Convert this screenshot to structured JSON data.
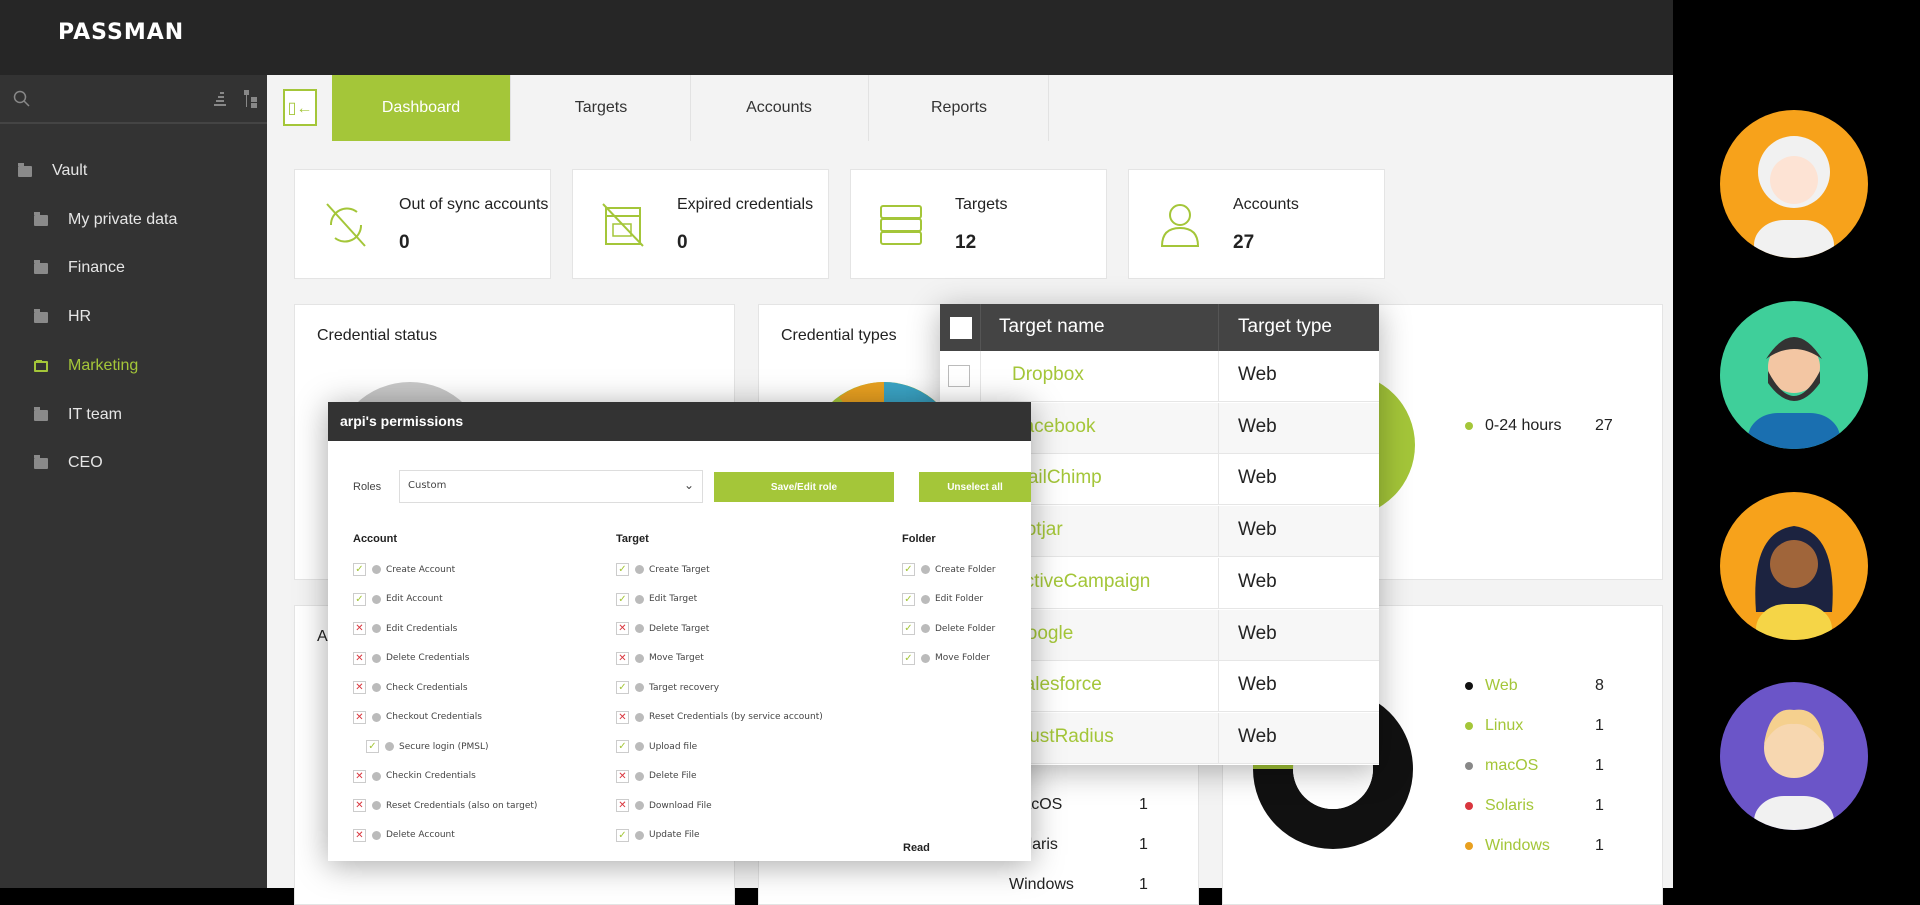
{
  "app": {
    "logo": "PASSMAN"
  },
  "sidebar": {
    "items": [
      {
        "label": "Vault",
        "icon": "folder-open-icon",
        "active": false
      },
      {
        "label": "My private data",
        "icon": "folder-icon",
        "active": false
      },
      {
        "label": "Finance",
        "icon": "folder-icon",
        "active": false
      },
      {
        "label": "HR",
        "icon": "folder-icon",
        "active": false
      },
      {
        "label": "Marketing",
        "icon": "folder-icon",
        "active": true
      },
      {
        "label": "IT team",
        "icon": "folder-icon",
        "active": false
      },
      {
        "label": "CEO",
        "icon": "folder-icon",
        "active": false
      }
    ]
  },
  "tabs": [
    {
      "label": "Dashboard",
      "active": true
    },
    {
      "label": "Targets"
    },
    {
      "label": "Accounts"
    },
    {
      "label": "Reports"
    }
  ],
  "cards": [
    {
      "label": "Out of sync accounts",
      "value": "0",
      "icon": "sync-off-icon"
    },
    {
      "label": "Expired credentials",
      "value": "0",
      "icon": "calendar-off-icon"
    },
    {
      "label": "Targets",
      "value": "12",
      "icon": "server-icon"
    },
    {
      "label": "Accounts",
      "value": "27",
      "icon": "user-icon"
    }
  ],
  "panels": {
    "credential_status": "Credential status",
    "credential_types": "Credential types",
    "row2_first_partial": "Ac",
    "age_legend": [
      {
        "label": "0-24 hours",
        "value": "27",
        "color": "#a4c639"
      }
    ],
    "types_legend_partial": [
      {
        "label": "macOS",
        "value": "1"
      },
      {
        "label": "Solaris",
        "value": "1"
      },
      {
        "label": "Windows",
        "value": "1"
      }
    ],
    "target_type_legend": [
      {
        "label": "Web",
        "value": "8",
        "color": "#111111"
      },
      {
        "label": "Linux",
        "value": "1",
        "color": "#a4c639"
      },
      {
        "label": "macOS",
        "value": "1",
        "color": "#888888"
      },
      {
        "label": "Solaris",
        "value": "1",
        "color": "#d9363e"
      },
      {
        "label": "Windows",
        "value": "1",
        "color": "#e8a020"
      }
    ]
  },
  "modal": {
    "title": "arpi's permissions",
    "roles_label": "Roles",
    "roles_value": "Custom",
    "save_label": "Save/Edit role",
    "unselect_label": "Unselect all",
    "read_label": "Read",
    "columns": [
      {
        "title": "Account",
        "items": [
          {
            "label": "Create Account",
            "on": true
          },
          {
            "label": "Edit Account",
            "on": true
          },
          {
            "label": "Edit Credentials",
            "on": false
          },
          {
            "label": "Delete Credentials",
            "on": false
          },
          {
            "label": "Check Credentials",
            "on": false
          },
          {
            "label": "Checkout Credentials",
            "on": false
          },
          {
            "label": "Secure login (PMSL)",
            "on": true,
            "indent": true
          },
          {
            "label": "Checkin Credentials",
            "on": false
          },
          {
            "label": "Reset Credentials (also on target)",
            "on": false
          },
          {
            "label": "Delete Account",
            "on": false
          }
        ]
      },
      {
        "title": "Target",
        "items": [
          {
            "label": "Create Target",
            "on": true
          },
          {
            "label": "Edit Target",
            "on": true
          },
          {
            "label": "Delete Target",
            "on": false
          },
          {
            "label": "Move Target",
            "on": false
          },
          {
            "label": "Target recovery",
            "on": true
          },
          {
            "label": "Reset Credentials (by service account)",
            "on": false
          },
          {
            "label": "Upload file",
            "on": true
          },
          {
            "label": "Delete File",
            "on": false
          },
          {
            "label": "Download File",
            "on": false
          },
          {
            "label": "Update File",
            "on": true
          }
        ]
      },
      {
        "title": "Folder",
        "items": [
          {
            "label": "Create Folder",
            "on": true
          },
          {
            "label": "Edit Folder",
            "on": true
          },
          {
            "label": "Delete Folder",
            "on": true
          },
          {
            "label": "Move Folder",
            "on": true
          }
        ]
      }
    ]
  },
  "targets_table": {
    "headers": [
      "Target name",
      "Target type"
    ],
    "rows": [
      [
        "Dropbox",
        "Web"
      ],
      [
        "Facebook",
        "Web"
      ],
      [
        "MailChimp",
        "Web"
      ],
      [
        "Hotjar",
        "Web"
      ],
      [
        "ActiveCampaign",
        "Web"
      ],
      [
        "Google",
        "Web"
      ],
      [
        "Salesforce",
        "Web"
      ],
      [
        "TrustRadius",
        "Web"
      ]
    ]
  },
  "colors": {
    "accent": "#a4c639",
    "dark": "#262626"
  }
}
